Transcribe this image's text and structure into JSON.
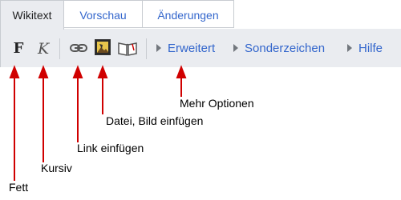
{
  "tabs": {
    "wikitext": "Wikitext",
    "preview": "Vorschau",
    "changes": "Änderungen"
  },
  "toolbar": {
    "bold_label": "F",
    "italic_label": "K",
    "groups": {
      "advanced": "Erweitert",
      "special_chars": "Sonderzeichen",
      "help": "Hilfe"
    }
  },
  "annotations": {
    "bold": "Fett",
    "italic": "Kursiv",
    "link": "Link einfügen",
    "image": "Datei, Bild einfügen",
    "more": "Mehr Optionen"
  },
  "icons": {
    "link": "chain-link-icon",
    "image": "image-icon",
    "reference": "book-icon",
    "expand": "triangle-right-icon"
  },
  "colors": {
    "link": "#3366cc",
    "toolbar_bg": "#eaecf0",
    "border": "#c8ccd1",
    "arrow": "#d00000"
  }
}
